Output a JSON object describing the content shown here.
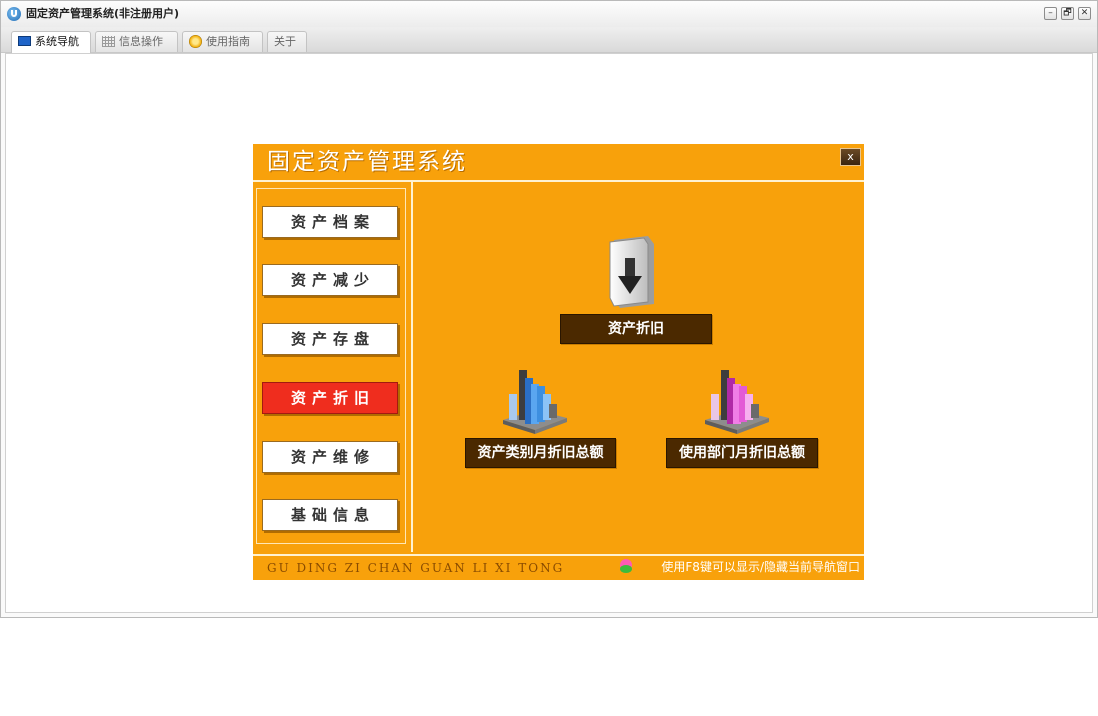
{
  "window": {
    "title": "固定资产管理系统(非注册用户)",
    "controls": {
      "minimize": "–",
      "restore": "🗗",
      "close": "✕"
    }
  },
  "tabs": [
    {
      "label": "系统导航",
      "icon": "nav-icon",
      "active": true
    },
    {
      "label": "信息操作",
      "icon": "grid-icon",
      "active": false
    },
    {
      "label": "使用指南",
      "icon": "guide-icon",
      "active": false
    },
    {
      "label": "关于",
      "icon": "",
      "active": false
    }
  ],
  "panel": {
    "title": "固定资产管理系统",
    "close_label": "x",
    "sidebar": [
      {
        "label": "资产档案",
        "active": false
      },
      {
        "label": "资产减少",
        "active": false
      },
      {
        "label": "资产存盘",
        "active": false
      },
      {
        "label": "资产折旧",
        "active": true
      },
      {
        "label": "资产维修",
        "active": false
      },
      {
        "label": "基础信息",
        "active": false
      }
    ],
    "functions": {
      "depreciation": "资产折旧",
      "category_monthly": "资产类别月折旧总额",
      "department_monthly": "使用部门月折旧总额"
    },
    "footer_pinyin": "GU DING ZI CHAN GUAN LI XI TONG",
    "footer_tip": "使用F8键可以显示/隐藏当前导航窗口"
  },
  "colors": {
    "panel_orange": "#f8a10b",
    "active_nav_red": "#ef2d1e",
    "label_brown": "#4b2900",
    "chart_blue": "#3d8fe0",
    "chart_pink": "#e35bd6"
  }
}
